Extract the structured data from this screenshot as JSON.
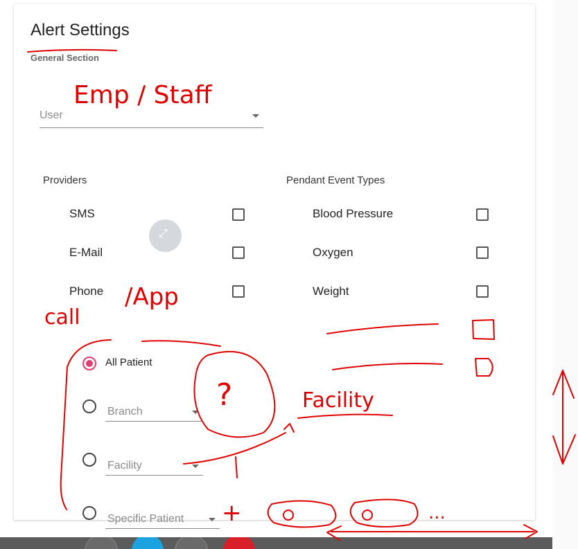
{
  "page": {
    "title": "Alert Settings",
    "section_label": "General Section"
  },
  "user_select": {
    "placeholder": "User"
  },
  "providers": {
    "title": "Providers",
    "items": [
      {
        "label": "SMS",
        "checked": false
      },
      {
        "label": "E-Mail",
        "checked": false
      },
      {
        "label": "Phone",
        "checked": false
      }
    ]
  },
  "pendant_event_types": {
    "title": "Pendant Event Types",
    "items": [
      {
        "label": "Blood Pressure",
        "checked": false
      },
      {
        "label": "Oxygen",
        "checked": false
      },
      {
        "label": "Weight",
        "checked": false
      }
    ]
  },
  "patient_scope": {
    "options": [
      {
        "label": "All Patient",
        "selected": true
      },
      {
        "label": "Branch",
        "selected": false,
        "type": "select"
      },
      {
        "label": "Facility",
        "selected": false,
        "type": "select"
      },
      {
        "label": "Specific Patient",
        "selected": false,
        "type": "select"
      }
    ]
  },
  "annotations": {
    "user_note": "Emp / Staff",
    "phone_note_1": "call",
    "phone_note_2": "/App",
    "facility_note": "Facility",
    "question_mark": "?",
    "dots": "...",
    "plus": "+",
    "ink_color": "#e00000"
  },
  "colors": {
    "radio_accent": "#e23b6e",
    "bottom_bar": "#5b5b5b"
  },
  "expand_button": {
    "icon": "expand-icon"
  }
}
